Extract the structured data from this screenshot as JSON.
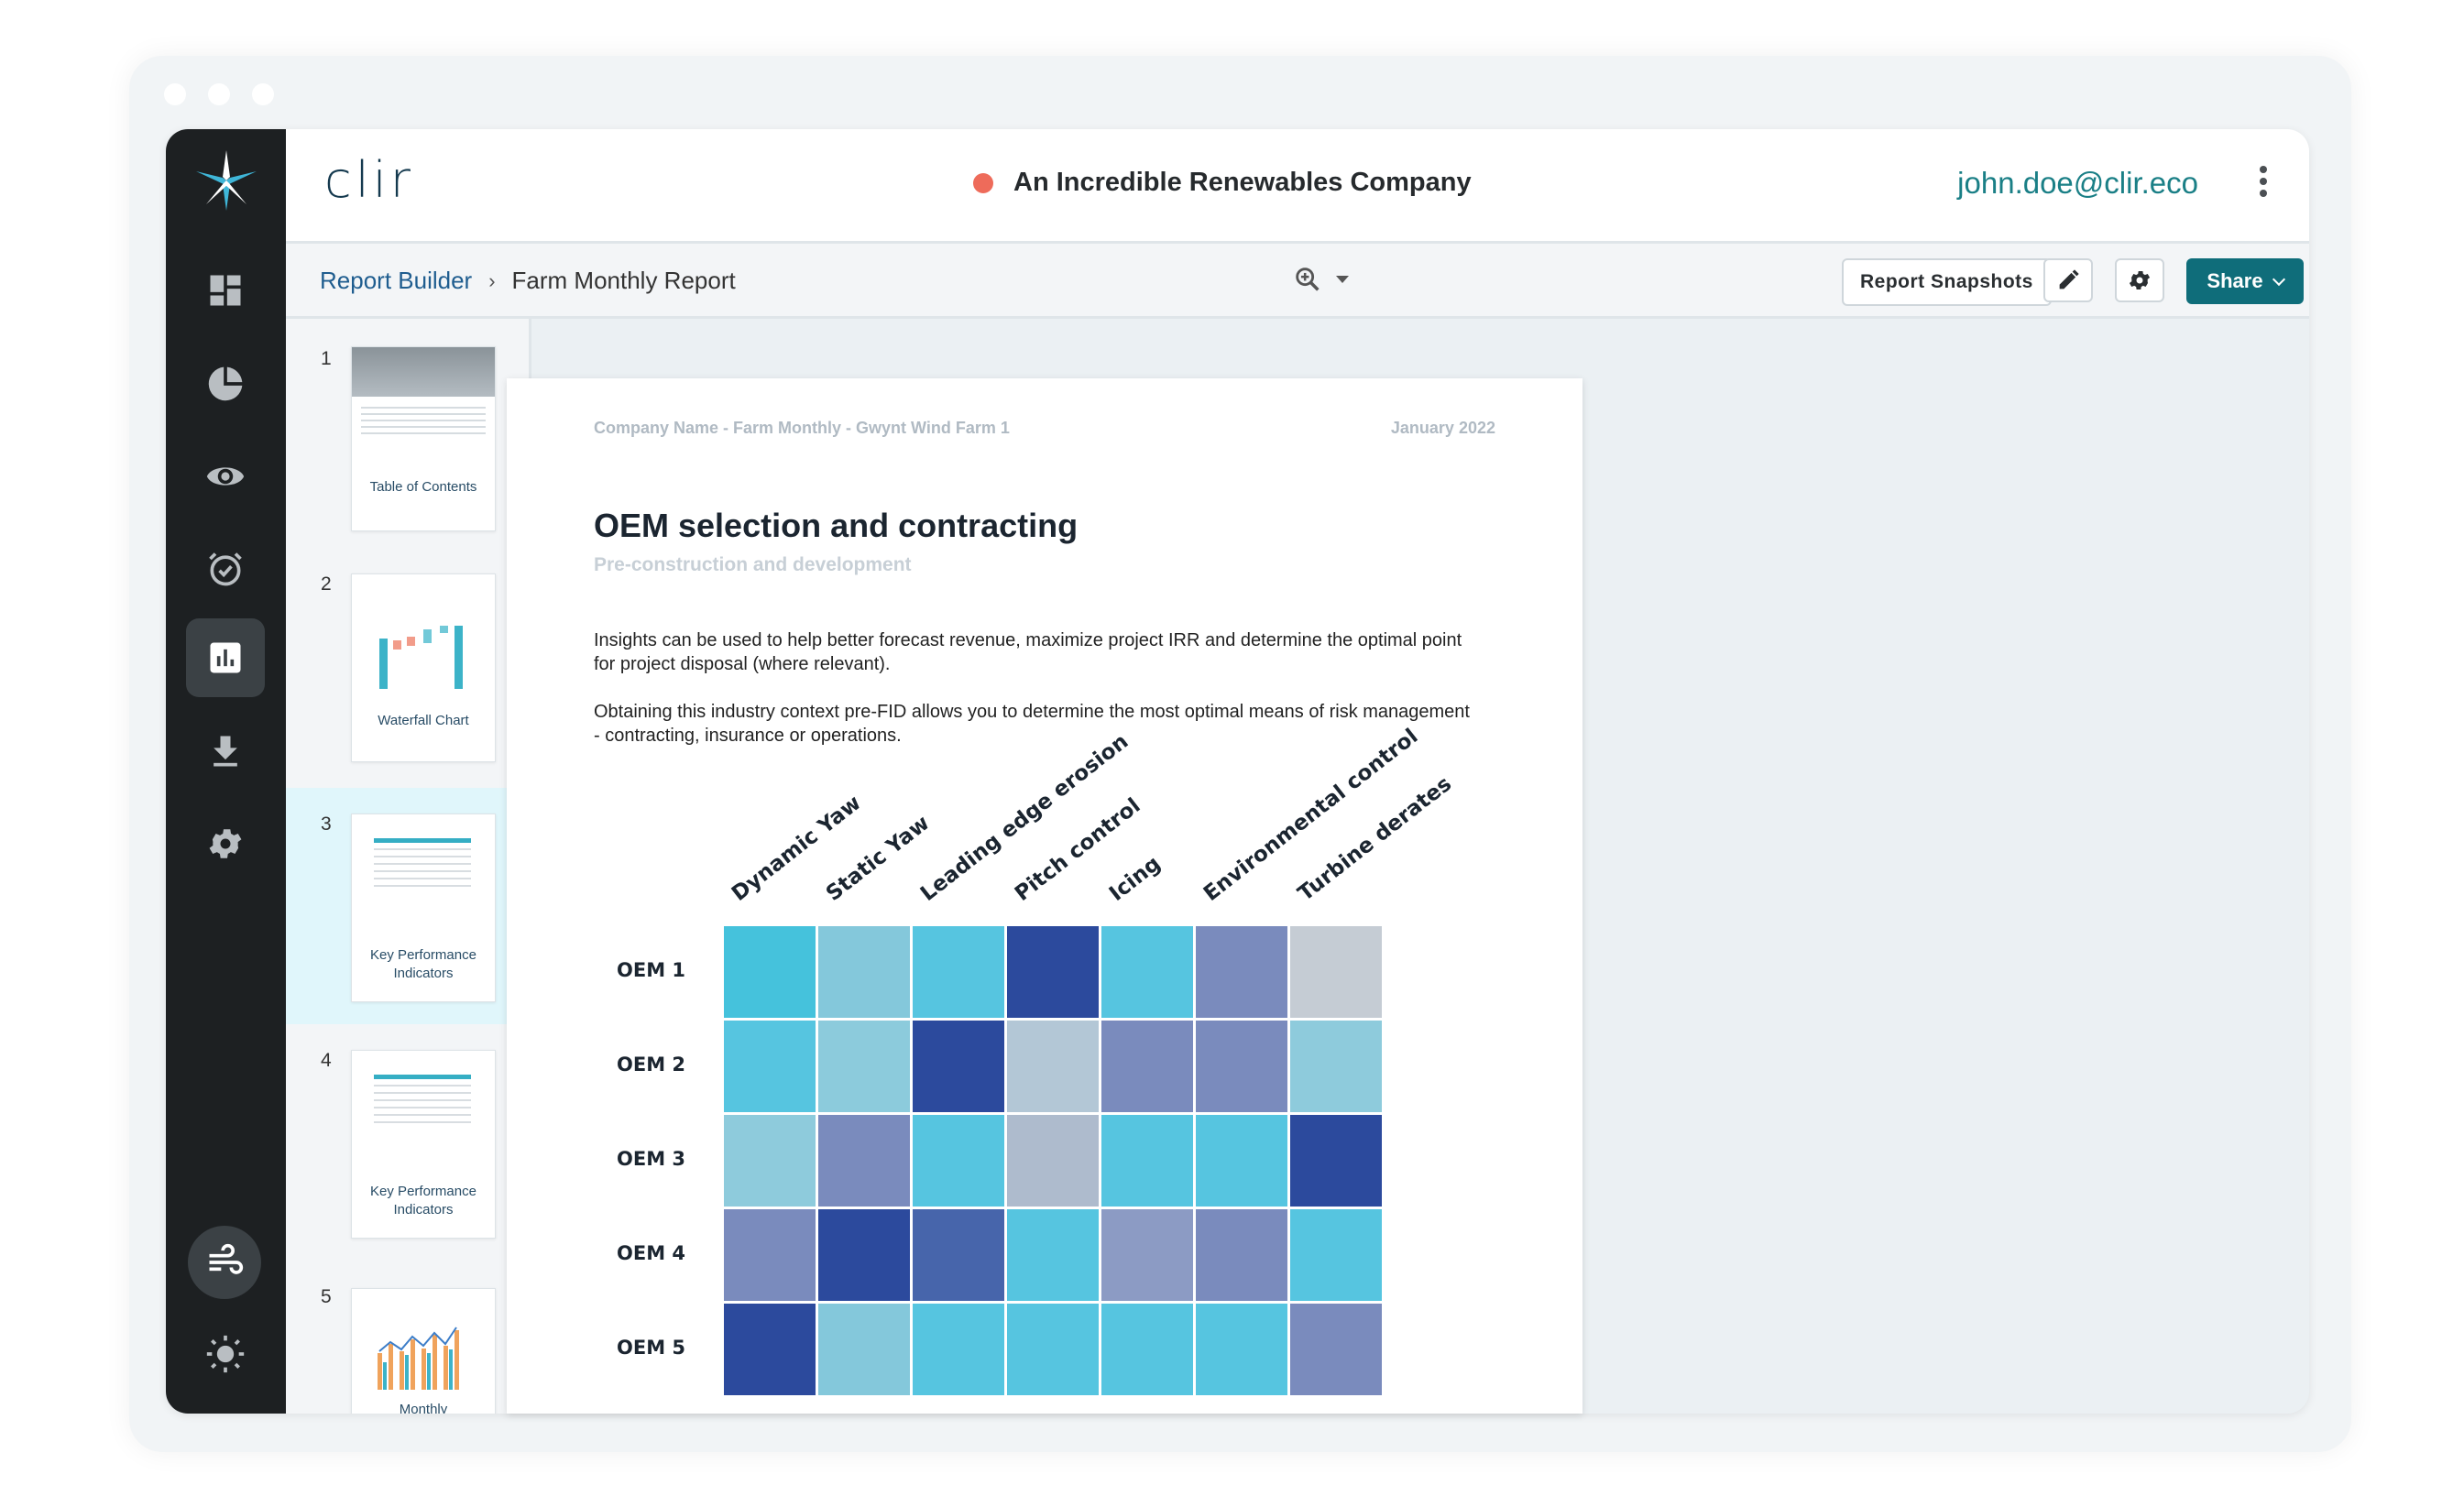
{
  "header": {
    "brand": "clir",
    "company_name": "An Incredible Renewables Company",
    "user_email": "john.doe@clir.eco"
  },
  "toolbar": {
    "breadcrumb_root": "Report Builder",
    "breadcrumb_current": "Farm Monthly Report",
    "report_snapshots_label": "Report Snapshots",
    "share_label": "Share"
  },
  "sidebar": {
    "items": [
      {
        "icon": "dashboard-icon"
      },
      {
        "icon": "pie-chart-icon"
      },
      {
        "icon": "eye-icon"
      },
      {
        "icon": "alarm-check-icon"
      },
      {
        "icon": "bar-chart-icon",
        "active": true
      },
      {
        "icon": "download-icon"
      },
      {
        "icon": "gear-icon"
      }
    ],
    "bottom": [
      {
        "icon": "wind-icon"
      },
      {
        "icon": "sun-icon"
      }
    ]
  },
  "thumbnails": [
    {
      "number": "1",
      "label": "Table of Contents"
    },
    {
      "number": "2",
      "label": "Waterfall Chart"
    },
    {
      "number": "3",
      "label": "Key Performance Indicators",
      "active": true
    },
    {
      "number": "4",
      "label": "Key Performance Indicators"
    },
    {
      "number": "5",
      "label": "Monthly"
    }
  ],
  "page": {
    "meta_left": "Company Name - Farm Monthly - Gwynt Wind Farm 1",
    "meta_right": "January 2022",
    "title": "OEM selection and contracting",
    "subtitle": "Pre-construction and development",
    "paragraph1": "Insights can be used to help better forecast revenue, maximize project IRR and determine the optimal point for project disposal (where relevant).",
    "paragraph2": "Obtaining this industry context pre-FID allows you to determine the most optimal means of risk management - contracting, insurance or operations."
  },
  "chart_data": {
    "type": "heatmap",
    "columns": [
      "Dynamic Yaw",
      "Static Yaw",
      "Leading edge erosion",
      "Pitch control",
      "Icing",
      "Environmental control",
      "Turbine derates"
    ],
    "rows": [
      "OEM 1",
      "OEM 2",
      "OEM 3",
      "OEM 4",
      "OEM 5"
    ],
    "cells": [
      [
        "#45c2dc",
        "#84c8db",
        "#56c5e0",
        "#2c4a9d",
        "#56c5e0",
        "#7a8bbd",
        "#c5ccd4"
      ],
      [
        "#56c5e0",
        "#8ccbdc",
        "#2c4a9d",
        "#b3c7d6",
        "#7a8bbd",
        "#7a8bbd",
        "#8ecbdc"
      ],
      [
        "#8ecbdc",
        "#7a8bbd",
        "#56c5e0",
        "#aebbcd",
        "#56c5e0",
        "#56c5e0",
        "#2c4a9d"
      ],
      [
        "#7a8bbd",
        "#2c4a9d",
        "#4765ab",
        "#56c5e0",
        "#8c9bc4",
        "#7a8bbd",
        "#56c5e0"
      ],
      [
        "#2c4a9d",
        "#84c8db",
        "#56c5e0",
        "#56c5e0",
        "#56c5e0",
        "#56c5e0",
        "#7a8bbd"
      ]
    ]
  }
}
